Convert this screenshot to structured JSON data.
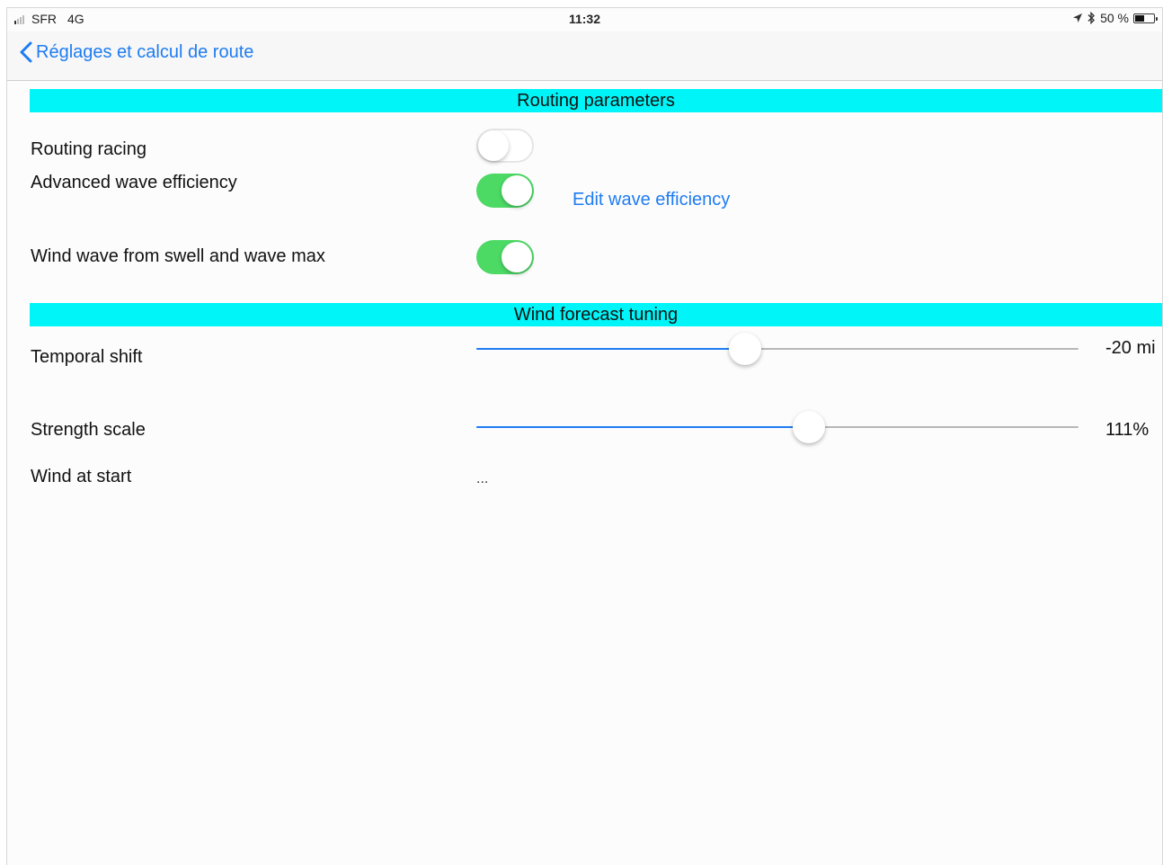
{
  "status_bar": {
    "carrier": "SFR",
    "network": "4G",
    "time": "11:32",
    "battery": "50 %",
    "battery_level": 0.5,
    "icons": [
      "signal-icon",
      "location-arrow-icon",
      "bluetooth-icon",
      "battery-icon"
    ]
  },
  "nav": {
    "back_label": "Réglages et calcul de route"
  },
  "routing": {
    "header": "Routing parameters",
    "routing_racing": {
      "label": "Routing racing",
      "on": false
    },
    "advanced_wave": {
      "label": "Advanced wave efficiency",
      "on": true
    },
    "edit_wave_link": "Edit wave efficiency",
    "wind_wave": {
      "label": "Wind wave from swell and wave max",
      "on": true
    }
  },
  "wind": {
    "header": "Wind forecast tuning",
    "temporal_shift": {
      "label": "Temporal shift",
      "value_text": "-20 mi",
      "fraction": 0.446
    },
    "strength_scale": {
      "label": "Strength scale",
      "value_text": "111%",
      "fraction": 0.552
    },
    "wind_at_start": {
      "label": "Wind at start",
      "value_text": "..."
    }
  },
  "colors": {
    "accent": "#1e7cf2",
    "section_header": "#00f5f8",
    "toggle_on": "#4cd964"
  }
}
